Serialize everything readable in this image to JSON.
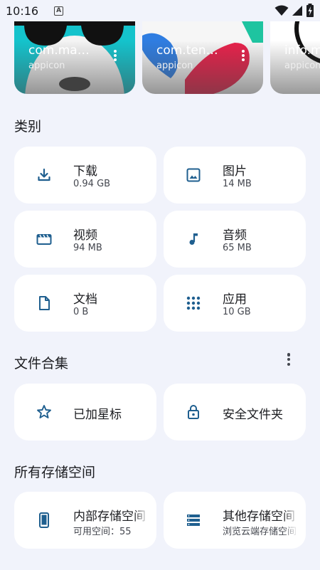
{
  "status_bar": {
    "time": "10:16",
    "notification_letter": "A"
  },
  "recent_files": [
    {
      "title": "com.ma…",
      "subtitle": "appicon"
    },
    {
      "title": "com.ten…",
      "subtitle": "appicon"
    },
    {
      "title": "info.m…",
      "subtitle": "appicon"
    }
  ],
  "categories": {
    "title": "类别",
    "items": [
      {
        "label": "下载",
        "size": "0.94 GB",
        "icon": "download-icon"
      },
      {
        "label": "图片",
        "size": "14 MB",
        "icon": "image-icon"
      },
      {
        "label": "视频",
        "size": "94 MB",
        "icon": "movie-icon"
      },
      {
        "label": "音频",
        "size": "65 MB",
        "icon": "music-note-icon"
      },
      {
        "label": "文档",
        "size": "0 B",
        "icon": "document-icon"
      },
      {
        "label": "应用",
        "size": "10 GB",
        "icon": "apps-grid-icon"
      }
    ]
  },
  "collections": {
    "title": "文件合集",
    "items": [
      {
        "label": "已加星标",
        "icon": "star-icon"
      },
      {
        "label": "安全文件夹",
        "icon": "lock-icon"
      }
    ]
  },
  "storage": {
    "title": "所有存储空间",
    "items": [
      {
        "label": "内部存储空间",
        "sub": "可用空间：55",
        "icon": "phone-icon"
      },
      {
        "label": "其他存储空间",
        "sub": "浏览云端存储空间",
        "icon": "storage-icon"
      }
    ]
  },
  "colors": {
    "accent": "#1f5f8f",
    "background": "#f1f3fb",
    "card": "#ffffff"
  }
}
